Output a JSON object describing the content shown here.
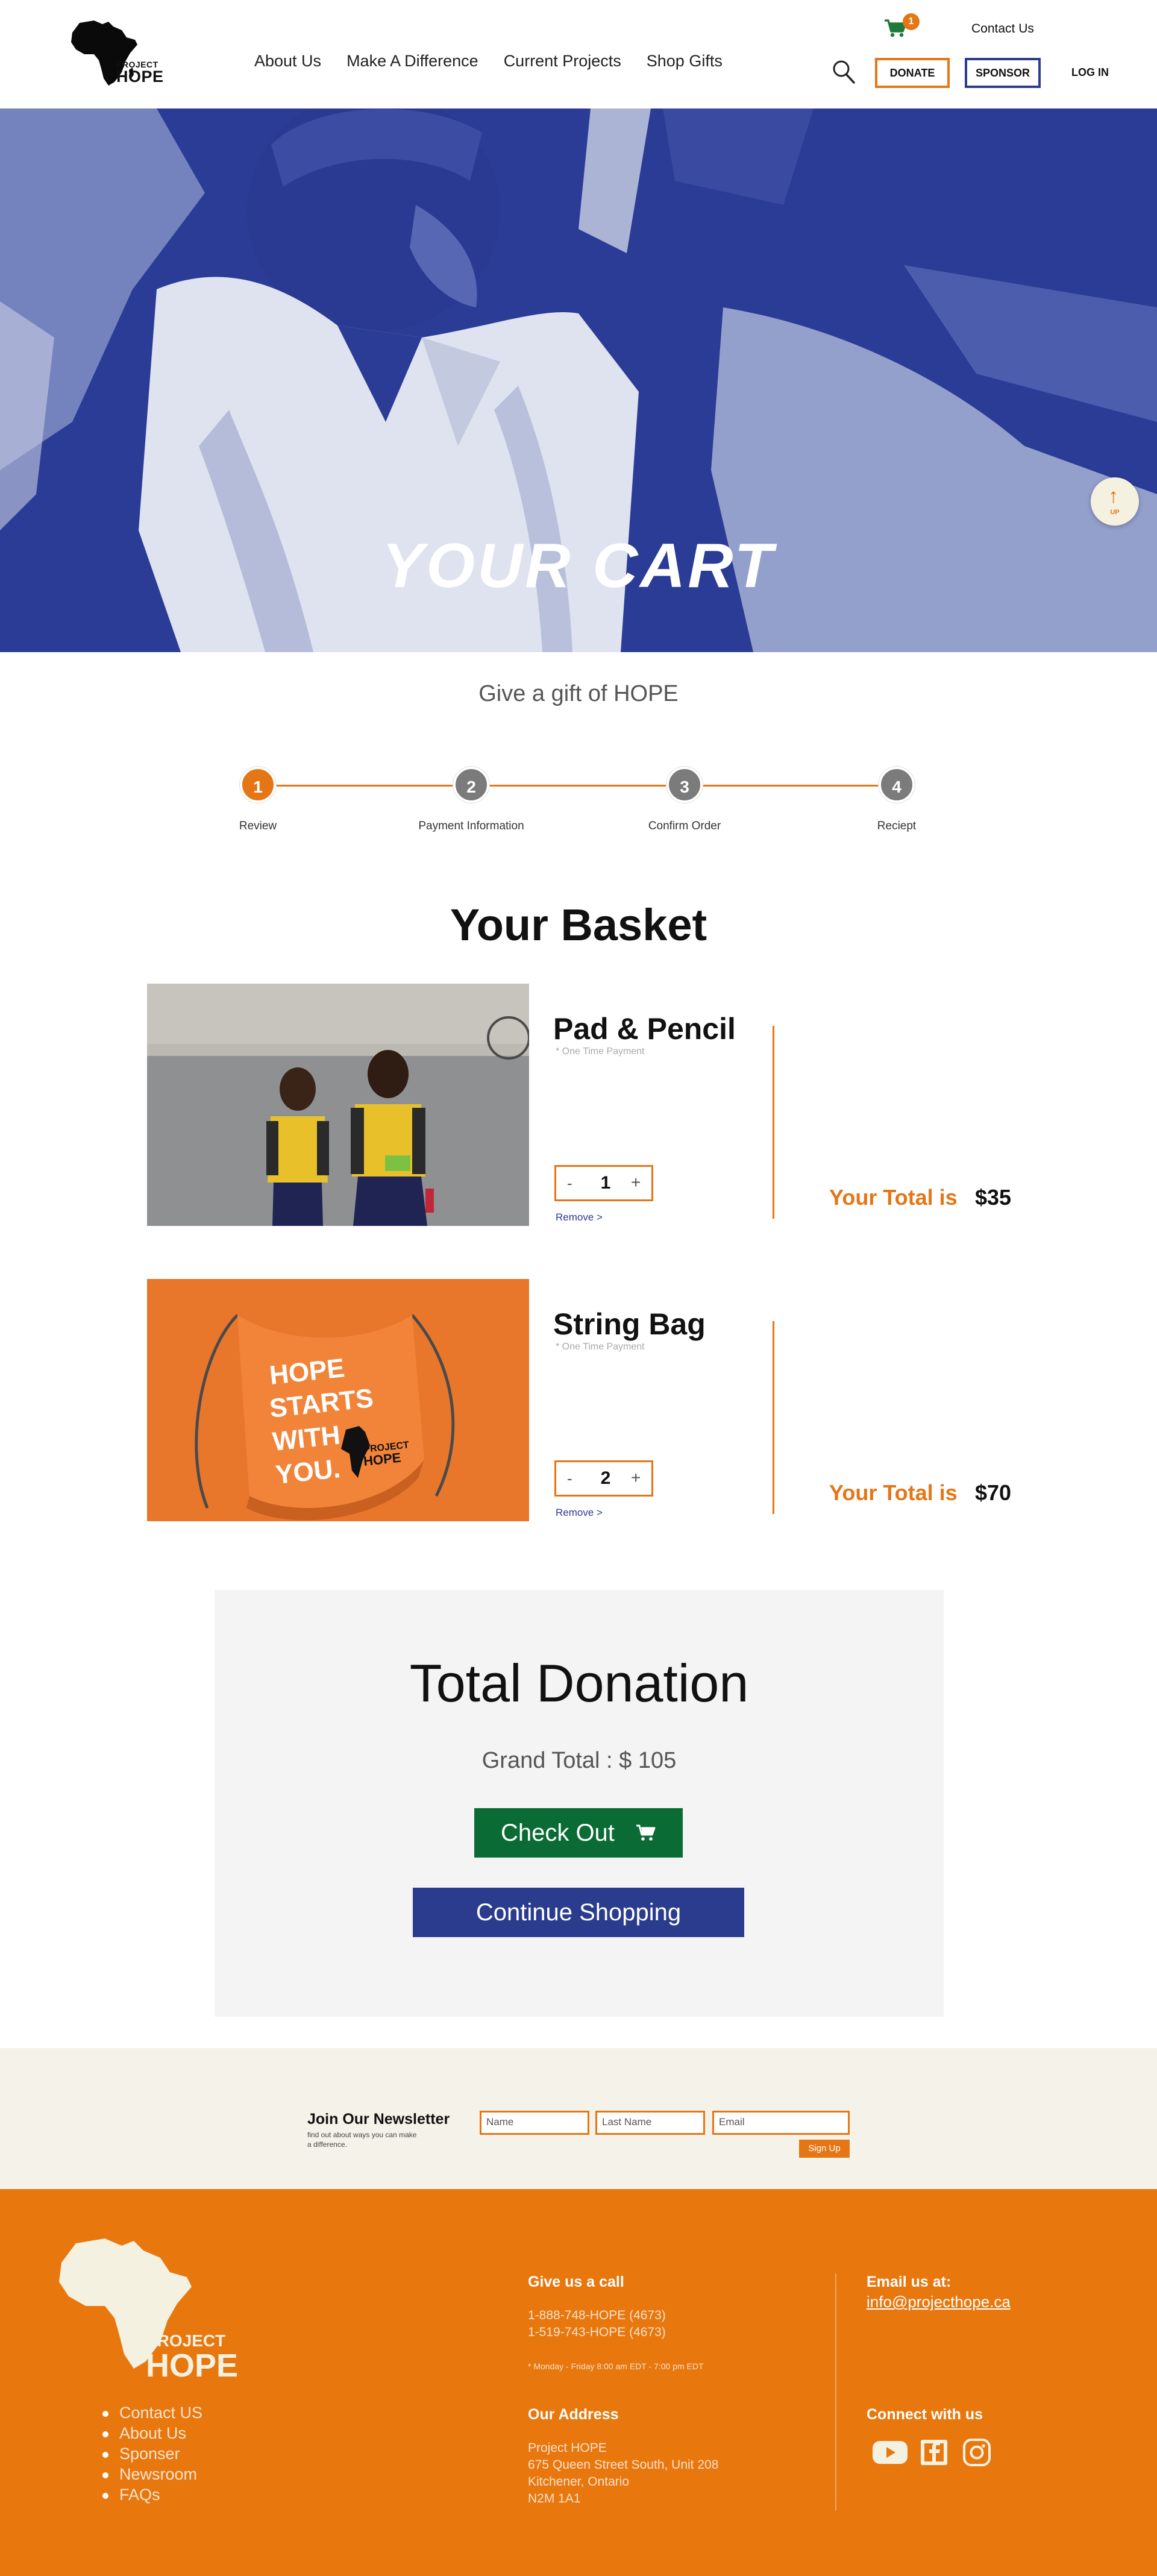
{
  "header": {
    "logo": {
      "line1": "PROJECT",
      "line2": "HOPE"
    },
    "nav": [
      "About Us",
      "Make A Difference",
      "Current Projects",
      "Shop Gifts"
    ],
    "cart_count": "1",
    "contact": "Contact Us",
    "donate": "DONATE",
    "sponsor": "SPONSOR",
    "login": "LOG IN"
  },
  "hero": {
    "title": "YOUR CART",
    "up_label": "UP"
  },
  "gift_text": "Give a gift of HOPE",
  "steps": [
    {
      "num": "1",
      "label": "Review",
      "active": true
    },
    {
      "num": "2",
      "label": "Payment Information",
      "active": false
    },
    {
      "num": "3",
      "label": "Confirm Order",
      "active": false
    },
    {
      "num": "4",
      "label": "Reciept",
      "active": false
    }
  ],
  "basket": {
    "title": "Your Basket",
    "items": [
      {
        "name": "Pad & Pencil",
        "payment": "* One Time Payment",
        "qty": "1",
        "remove": "Remove >",
        "total_label": "Your Total is",
        "total": "$35"
      },
      {
        "name": "String Bag",
        "payment": "* One Time Payment",
        "qty": "2",
        "remove": "Remove >",
        "total_label": "Your Total is",
        "total": "$70",
        "bag_text": [
          "HOPE",
          "STARTS",
          "WITH",
          "YOU."
        ],
        "bag_logo": [
          "PROJECT",
          "HOPE"
        ]
      }
    ]
  },
  "donation": {
    "title": "Total Donation",
    "grand_total": "Grand Total : $ 105",
    "checkout": "Check Out",
    "continue": "Continue Shopping"
  },
  "newsletter": {
    "title": "Join Our Newsletter",
    "subtitle": "find out about ways you can make a difference.",
    "name_placeholder": "Name",
    "last_name_placeholder": "Last Name",
    "email_placeholder": "Email",
    "signup": "Sign Up"
  },
  "footer": {
    "logo": {
      "line1": "PROJECT",
      "line2": "HOPE"
    },
    "links": [
      "Contact US",
      "About Us",
      "Sponser",
      "Newsroom",
      "FAQs"
    ],
    "call_title": "Give us a call",
    "phone1": "1-888-748-HOPE (4673)",
    "phone2": "1-519-743-HOPE (4673)",
    "hours": "* Monday - Friday 8:00 am EDT - 7:00 pm EDT",
    "address_title": "Our Address",
    "address": [
      "Project HOPE",
      "675 Queen Street South, Unit 208",
      "Kitchener, Ontario",
      "N2M 1A1"
    ],
    "email_title": "Email us at:",
    "email": "info@projecthope.ca",
    "connect_title": "Connect with us",
    "social": [
      "youtube-icon",
      "facebook-icon",
      "instagram-icon"
    ]
  },
  "colors": {
    "orange": "#e57616",
    "blue": "#2b3c96",
    "green": "#0b6b35",
    "cream": "#f5f3e9"
  }
}
